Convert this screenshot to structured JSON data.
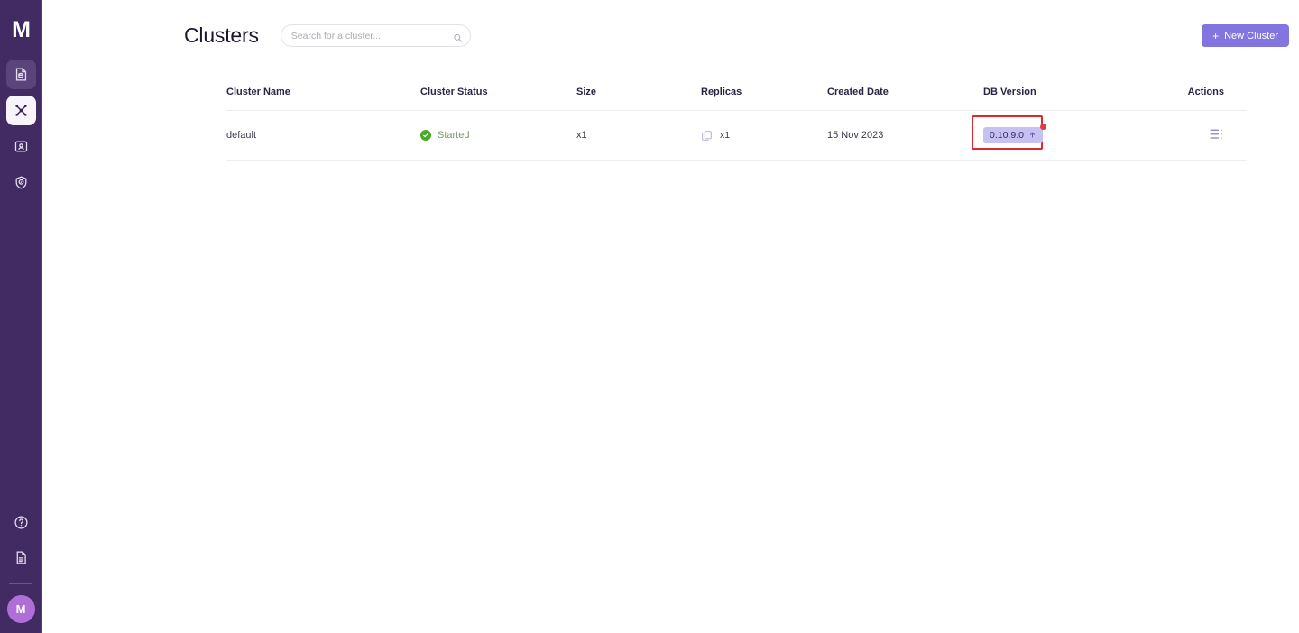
{
  "app": {
    "logo_text": "M",
    "avatar_initial": "M"
  },
  "sidebar": {
    "items": [
      {
        "name": "databases",
        "icon": "database-file-icon",
        "active": false,
        "hover": true
      },
      {
        "name": "clusters",
        "icon": "cluster-network-icon",
        "active": true,
        "hover": false
      },
      {
        "name": "account",
        "icon": "id-card-icon",
        "active": false,
        "hover": false
      },
      {
        "name": "security",
        "icon": "shield-compass-icon",
        "active": false,
        "hover": false
      }
    ],
    "bottom_items": [
      {
        "name": "help",
        "icon": "help-circle-icon"
      },
      {
        "name": "docs",
        "icon": "document-icon"
      }
    ]
  },
  "header": {
    "title": "Clusters",
    "new_cluster_label": "New Cluster",
    "plus_icon": "plus-icon"
  },
  "search": {
    "value": "",
    "placeholder": "Search for a cluster...",
    "icon": "search-icon"
  },
  "table": {
    "columns": [
      "Cluster Name",
      "Cluster Status",
      "Size",
      "Replicas",
      "Created Date",
      "DB Version",
      "Actions"
    ],
    "rows": [
      {
        "cluster_name": "default",
        "cluster_status": "Started",
        "status_icon": "check-circle-icon",
        "size": "x1",
        "replicas": "x1",
        "replicas_icon": "copy-icon",
        "created_date": "15 Nov 2023",
        "db_version": "0.10.9.0",
        "db_version_icon": "upgrade-arrow-icon",
        "db_version_has_update": true,
        "actions_icon": "list-menu-icon"
      }
    ]
  },
  "colors": {
    "sidebar_bg": "#422a63",
    "accent_purple": "#8275e0",
    "status_green": "#4aaa24",
    "badge_bg": "#c6c1f0",
    "highlight_red": "#d92b2b",
    "avatar_purple": "#b06fd8"
  }
}
